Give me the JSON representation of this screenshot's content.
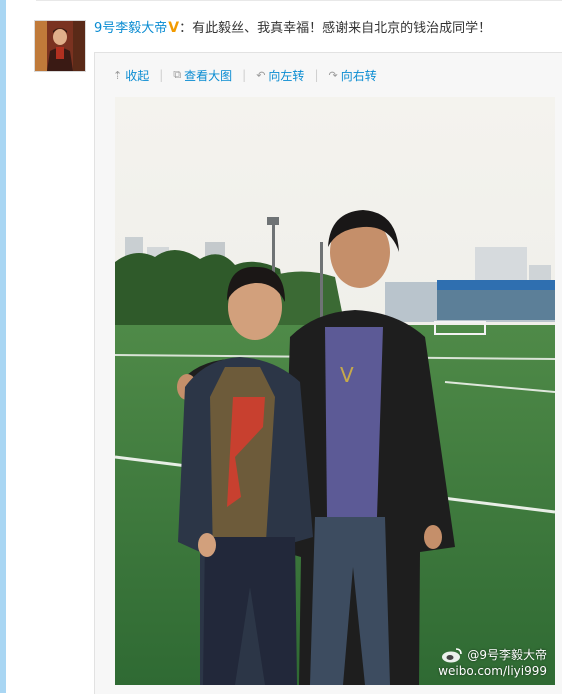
{
  "post": {
    "username": "9号李毅大帝",
    "verified_badge": "V",
    "separator": "：",
    "text": "有此毅丝、我真幸福！感谢来自北京的钱治成同学！"
  },
  "toolbar": {
    "collapse_label": "收起",
    "view_large_label": "查看大图",
    "rotate_left_label": "向左转",
    "rotate_right_label": "向右转",
    "collapse_icon": "arrow-up-icon",
    "view_large_icon": "external-link-icon",
    "rotate_left_icon": "rotate-left-icon",
    "rotate_right_icon": "rotate-right-icon"
  },
  "photo": {
    "watermark_handle": "@9号李毅大帝",
    "watermark_url": "weibo.com/liyi999",
    "watermark_icon": "weibo-logo-icon"
  },
  "colors": {
    "link": "#0a8cd2",
    "verified": "#f29b00",
    "left_strip": "#a9d6f3"
  }
}
